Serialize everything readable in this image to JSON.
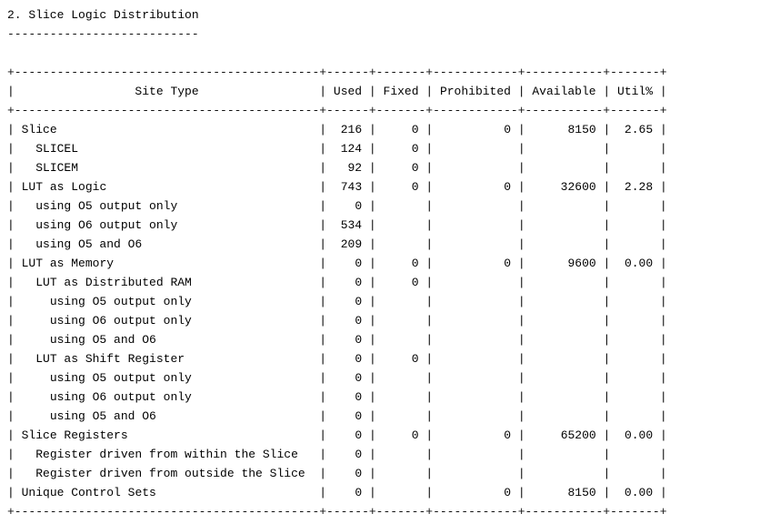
{
  "report": {
    "section_heading": "2. Slice Logic Distribution",
    "heading_underline": "---------------------------",
    "border": "+-------------------------------------------+------+-------+------------+-----------+-------+",
    "header": [
      "Site Type",
      "Used",
      "Fixed",
      "Prohibited",
      "Available",
      "Util%"
    ],
    "rows": [
      {
        "site": "Slice",
        "indent": 0,
        "used": "216",
        "fixed": "0",
        "prohibited": "0",
        "available": "8150",
        "util": "2.65"
      },
      {
        "site": "SLICEL",
        "indent": 1,
        "used": "124",
        "fixed": "0",
        "prohibited": "",
        "available": "",
        "util": ""
      },
      {
        "site": "SLICEM",
        "indent": 1,
        "used": "92",
        "fixed": "0",
        "prohibited": "",
        "available": "",
        "util": ""
      },
      {
        "site": "LUT as Logic",
        "indent": 0,
        "used": "743",
        "fixed": "0",
        "prohibited": "0",
        "available": "32600",
        "util": "2.28"
      },
      {
        "site": "using O5 output only",
        "indent": 1,
        "used": "0",
        "fixed": "",
        "prohibited": "",
        "available": "",
        "util": ""
      },
      {
        "site": "using O6 output only",
        "indent": 1,
        "used": "534",
        "fixed": "",
        "prohibited": "",
        "available": "",
        "util": ""
      },
      {
        "site": "using O5 and O6",
        "indent": 1,
        "used": "209",
        "fixed": "",
        "prohibited": "",
        "available": "",
        "util": ""
      },
      {
        "site": "LUT as Memory",
        "indent": 0,
        "used": "0",
        "fixed": "0",
        "prohibited": "0",
        "available": "9600",
        "util": "0.00"
      },
      {
        "site": "LUT as Distributed RAM",
        "indent": 1,
        "used": "0",
        "fixed": "0",
        "prohibited": "",
        "available": "",
        "util": ""
      },
      {
        "site": "using O5 output only",
        "indent": 2,
        "used": "0",
        "fixed": "",
        "prohibited": "",
        "available": "",
        "util": ""
      },
      {
        "site": "using O6 output only",
        "indent": 2,
        "used": "0",
        "fixed": "",
        "prohibited": "",
        "available": "",
        "util": ""
      },
      {
        "site": "using O5 and O6",
        "indent": 2,
        "used": "0",
        "fixed": "",
        "prohibited": "",
        "available": "",
        "util": ""
      },
      {
        "site": "LUT as Shift Register",
        "indent": 1,
        "used": "0",
        "fixed": "0",
        "prohibited": "",
        "available": "",
        "util": ""
      },
      {
        "site": "using O5 output only",
        "indent": 2,
        "used": "0",
        "fixed": "",
        "prohibited": "",
        "available": "",
        "util": ""
      },
      {
        "site": "using O6 output only",
        "indent": 2,
        "used": "0",
        "fixed": "",
        "prohibited": "",
        "available": "",
        "util": ""
      },
      {
        "site": "using O5 and O6",
        "indent": 2,
        "used": "0",
        "fixed": "",
        "prohibited": "",
        "available": "",
        "util": ""
      },
      {
        "site": "Slice Registers",
        "indent": 0,
        "used": "0",
        "fixed": "0",
        "prohibited": "0",
        "available": "65200",
        "util": "0.00"
      },
      {
        "site": "Register driven from within the Slice",
        "indent": 1,
        "used": "0",
        "fixed": "",
        "prohibited": "",
        "available": "",
        "util": ""
      },
      {
        "site": "Register driven from outside the Slice",
        "indent": 1,
        "used": "0",
        "fixed": "",
        "prohibited": "",
        "available": "",
        "util": ""
      },
      {
        "site": "Unique Control Sets",
        "indent": 0,
        "used": "0",
        "fixed": "",
        "prohibited": "0",
        "available": "8150",
        "util": "0.00"
      }
    ]
  }
}
